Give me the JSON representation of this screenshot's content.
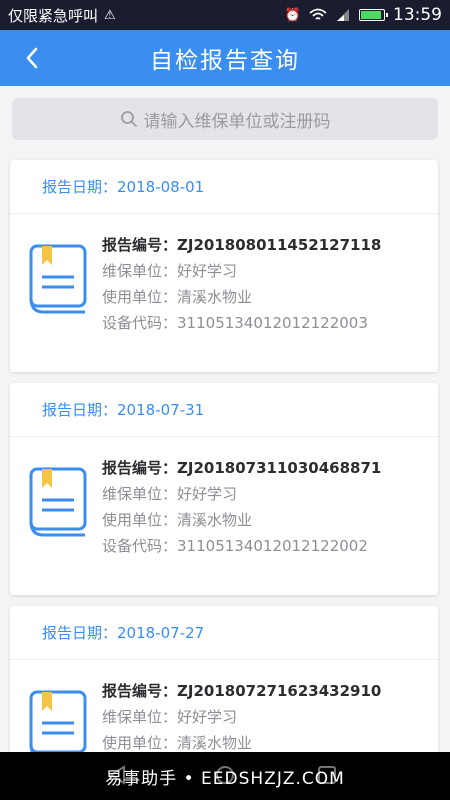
{
  "status_bar": {
    "left_text": "仅限紧急呼叫",
    "time": "13:59"
  },
  "header": {
    "title": "自检报告查询"
  },
  "search": {
    "placeholder": "请输入维保单位或注册码"
  },
  "labels": {
    "date": "报告日期：",
    "report_no": "报告编号：",
    "maintenance": "维保单位：",
    "user_unit": "使用单位：",
    "device_code": "设备代码："
  },
  "reports": [
    {
      "date": "2018-08-01",
      "report_no": "ZJ201808011452127118",
      "maintenance": "好好学习",
      "user_unit": "清溪水物业",
      "device_code": "31105134012012122003"
    },
    {
      "date": "2018-07-31",
      "report_no": "ZJ201807311030468871",
      "maintenance": "好好学习",
      "user_unit": "清溪水物业",
      "device_code": "31105134012012122002"
    },
    {
      "date": "2018-07-27",
      "report_no": "ZJ201807271623432910",
      "maintenance": "好好学习",
      "user_unit": "清溪水物业",
      "device_code": ""
    }
  ],
  "watermark": "易事助手 • EEDSHZJZ.COM",
  "colors": {
    "accent": "#3a8ef0",
    "status_bar": "#1a1c30"
  }
}
